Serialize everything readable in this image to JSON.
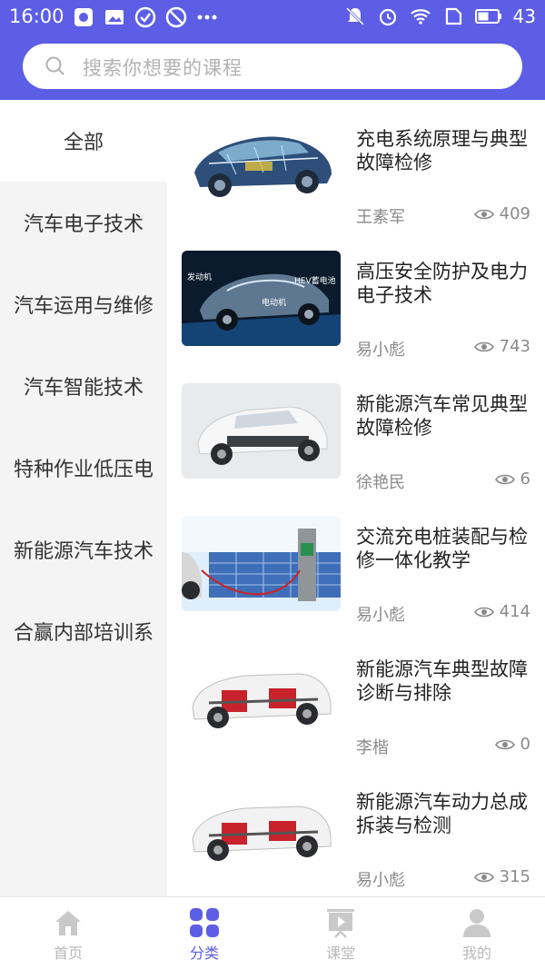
{
  "status_bar": {
    "time": "16:00",
    "battery": "43"
  },
  "search": {
    "placeholder": "搜索你想要的课程"
  },
  "sidebar": {
    "items": [
      {
        "label": "全部"
      },
      {
        "label": "汽车电子技术"
      },
      {
        "label": "汽车运用与维修"
      },
      {
        "label": "汽车智能技术"
      },
      {
        "label": "特种作业低压电"
      },
      {
        "label": "新能源汽车技术"
      },
      {
        "label": "合赢内部培训系"
      }
    ]
  },
  "courses": [
    {
      "title": "充电系统原理与典型故障检修",
      "author": "王素军",
      "views": "409"
    },
    {
      "title": "高压安全防护及电力电子技术",
      "author": "易小彪",
      "views": "743",
      "image_labels": [
        "发动机",
        "HEV蓄电池",
        "电动机"
      ]
    },
    {
      "title": "新能源汽车常见典型故障检修",
      "author": "徐艳民",
      "views": "6"
    },
    {
      "title": "交流充电桩装配与检修一体化教学",
      "author": "易小彪",
      "views": "414"
    },
    {
      "title": "新能源汽车典型故障诊断与排除",
      "author": "李楷",
      "views": "0"
    },
    {
      "title": "新能源汽车动力总成拆装与检测",
      "author": "易小彪",
      "views": "315"
    }
  ],
  "tabbar": {
    "tabs": [
      {
        "label": "首页",
        "icon": "home-icon"
      },
      {
        "label": "分类",
        "icon": "category-icon"
      },
      {
        "label": "课堂",
        "icon": "classroom-icon"
      },
      {
        "label": "我的",
        "icon": "profile-icon"
      }
    ]
  },
  "colors": {
    "accent": "#5c5ee6",
    "sidebar_bg": "#f4f4f4",
    "muted_text": "#8a8a8a",
    "inactive_tab": "#b8b8b8"
  }
}
